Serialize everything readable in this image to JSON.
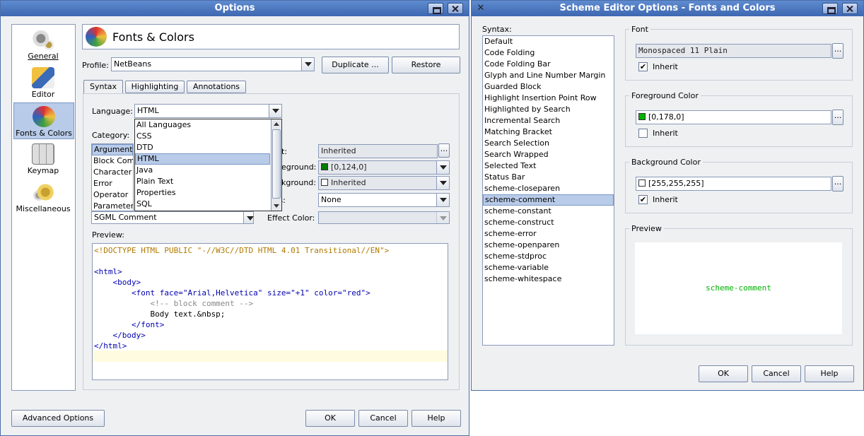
{
  "options": {
    "title": "Options",
    "categories": [
      {
        "label": "General",
        "icon": "gears-icon"
      },
      {
        "label": "Editor",
        "icon": "pencil-icon"
      },
      {
        "label": "Fonts & Colors",
        "icon": "fonts-colors-icon"
      },
      {
        "label": "Keymap",
        "icon": "keyboard-icon"
      },
      {
        "label": "Miscellaneous",
        "icon": "misc-gears-icon"
      }
    ],
    "header_title": "Fonts & Colors",
    "profile_label": "Profile:",
    "profile_value": "NetBeans",
    "duplicate_label": "Duplicate ...",
    "restore_label": "Restore",
    "tabs": [
      "Syntax",
      "Highlighting",
      "Annotations"
    ],
    "language_label": "Language:",
    "language_value": "HTML",
    "language_options": [
      "All Languages",
      "CSS",
      "DTD",
      "HTML",
      "Java",
      "Plain Text",
      "Properties",
      "SQL"
    ],
    "category_label": "Category:",
    "category_items": [
      "Argument",
      "Block Comm",
      "Character",
      "Error",
      "Operator",
      "Parameter",
      "SGML Comment"
    ],
    "font_value": "Inherited",
    "foreground_label_frag": "eground:",
    "foreground_value": "[0,124,0]",
    "background_label_frag": "kground:",
    "background_value": "Inherited",
    "effects_label_frag": "cts:",
    "effects_value": "None",
    "effect_color_label": "Effect Color:",
    "preview_label": "Preview:",
    "preview_lines": [
      "<!DOCTYPE HTML PUBLIC \"-//W3C//DTD HTML 4.01 Transitional//EN\">",
      "",
      "<html>",
      "    <body>",
      "        <font face=\"Arial,Helvetica\" size=\"+1\" color=\"red\">",
      "            <!-- block comment -->",
      "            Body text.&nbsp;",
      "        </font>",
      "    </body>",
      "</html>"
    ],
    "advanced_label": "Advanced Options",
    "ok_label": "OK",
    "cancel_label": "Cancel",
    "help_label": "Help"
  },
  "scheme": {
    "title": "Scheme Editor Options - Fonts and Colors",
    "syntax_label": "Syntax:",
    "syntax_items": [
      "Default",
      "Code Folding",
      "Code Folding Bar",
      "Glyph and Line Number Margin",
      "Guarded Block",
      "Highlight Insertion Point Row",
      "Highlighted by Search",
      "Incremental Search",
      "Matching Bracket",
      "Search Selection",
      "Search Wrapped",
      "Selected Text",
      "Status Bar",
      "scheme-closeparen",
      "scheme-comment",
      "scheme-constant",
      "scheme-construct",
      "scheme-error",
      "scheme-openparen",
      "scheme-stdproc",
      "scheme-variable",
      "scheme-whitespace"
    ],
    "selected_index": 14,
    "font_group": "Font",
    "font_value": "Monospaced 11 Plain",
    "inherit_label": "Inherit",
    "fg_group": "Foreground Color",
    "fg_value": "[0,178,0]",
    "bg_group": "Background Color",
    "bg_value": "[255,255,255]",
    "preview_group": "Preview",
    "preview_text": "scheme-comment",
    "ok_label": "OK",
    "cancel_label": "Cancel",
    "help_label": "Help"
  },
  "colors": {
    "accent": "#3d67b0",
    "selection": "#b8cbe8",
    "fg_green": "#007c00",
    "scheme_green": "#00b200"
  }
}
